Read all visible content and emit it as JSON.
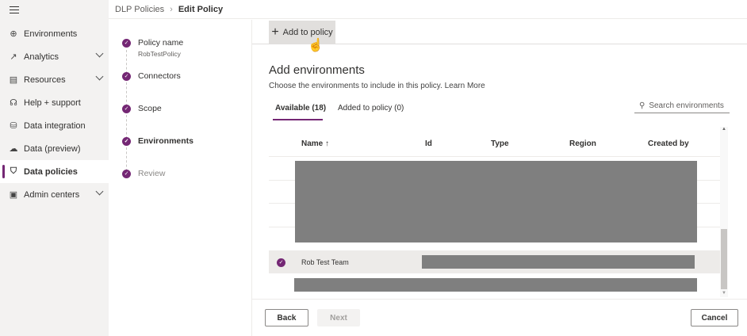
{
  "sidebar": {
    "items": [
      {
        "label": "Environments",
        "icon": "globe-icon"
      },
      {
        "label": "Analytics",
        "icon": "chart-icon"
      },
      {
        "label": "Resources",
        "icon": "resources-icon"
      },
      {
        "label": "Help + support",
        "icon": "headset-icon"
      },
      {
        "label": "Data integration",
        "icon": "data-integration-icon"
      },
      {
        "label": "Data (preview)",
        "icon": "cloud-icon"
      },
      {
        "label": "Data policies",
        "icon": "shield-icon"
      },
      {
        "label": "Admin centers",
        "icon": "admin-icon"
      }
    ]
  },
  "breadcrumb": {
    "parent": "DLP Policies",
    "current": "Edit Policy"
  },
  "steps": [
    {
      "label": "Policy name",
      "sub": "RobTestPolicy"
    },
    {
      "label": "Connectors"
    },
    {
      "label": "Scope"
    },
    {
      "label": "Environments"
    },
    {
      "label": "Review"
    }
  ],
  "toolbar": {
    "add_label": "Add to policy"
  },
  "main": {
    "title": "Add environments",
    "description": "Choose the environments to include in this policy.",
    "learn_more": "Learn More",
    "tabs": [
      {
        "label": "Available (18)"
      },
      {
        "label": "Added to policy (0)"
      }
    ],
    "search_placeholder": "Search environments",
    "columns": [
      "Name ↑",
      "Id",
      "Type",
      "Region",
      "Created by"
    ],
    "selected_row": {
      "name": "Rob Test Team"
    }
  },
  "footer": {
    "back": "Back",
    "next": "Next",
    "cancel": "Cancel"
  },
  "colors": {
    "accent": "#742774"
  }
}
